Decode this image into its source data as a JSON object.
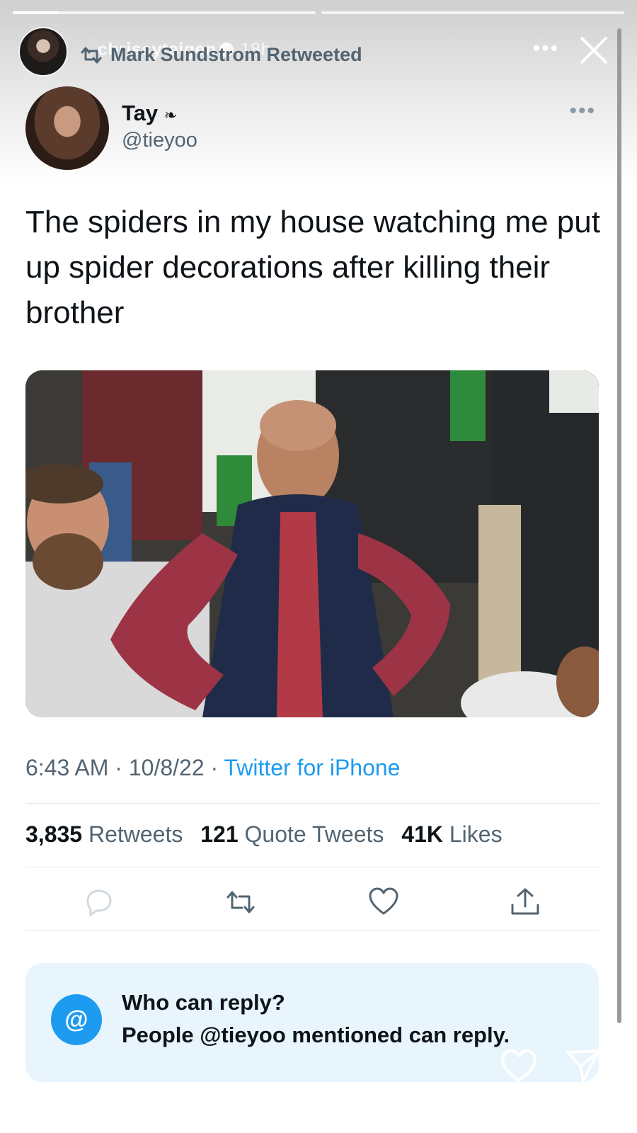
{
  "story": {
    "username": "chrissyteigen",
    "time": "18h",
    "progress_fraction_first_segment": 0.15
  },
  "retweet": {
    "text": "Mark Sundstrom Retweeted"
  },
  "tweet": {
    "author_name": "Tay",
    "author_emoji": "❧",
    "author_handle": "@tieyoo",
    "text": "The spiders in my house watching me put up spider decorations after killing their brother",
    "time": "6:43 AM",
    "date": "10/8/22",
    "source": "Twitter for iPhone",
    "stats": {
      "retweets_count": "3,835",
      "retweets_label": "Retweets",
      "quotes_count": "121",
      "quotes_label": "Quote Tweets",
      "likes_count": "41K",
      "likes_label": "Likes"
    }
  },
  "reply_settings": {
    "icon": "@",
    "title": "Who can reply?",
    "description": "People @tieyoo mentioned can reply."
  },
  "colors": {
    "twitter_blue": "#1d9bf0",
    "secondary_text": "#536471",
    "reply_box_bg": "#e8f5fd"
  }
}
